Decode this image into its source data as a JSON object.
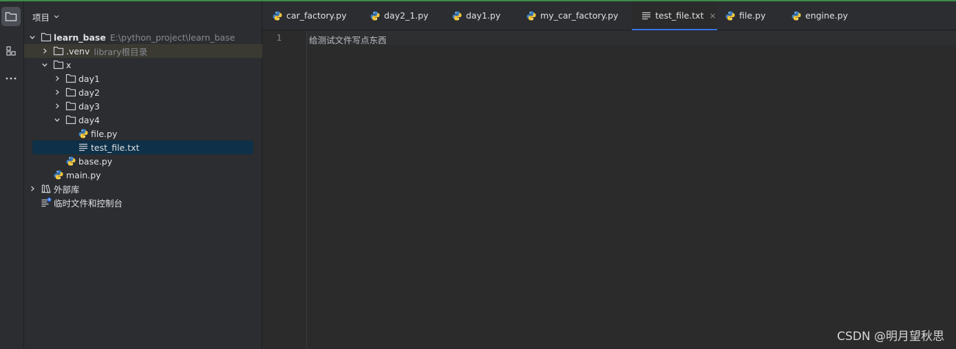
{
  "project_panel": {
    "title": "项目",
    "tree": [
      {
        "name": "learn_base",
        "hint": "E:\\python_project\\learn_base",
        "depth": 0,
        "expanded": true,
        "type": "folder"
      },
      {
        "name": ".venv",
        "hint": "library根目录",
        "depth": 1,
        "expanded": false,
        "type": "folder"
      },
      {
        "name": "x",
        "hint": "",
        "depth": 1,
        "expanded": true,
        "type": "folder"
      },
      {
        "name": "day1",
        "hint": "",
        "depth": 2,
        "expanded": false,
        "type": "folder"
      },
      {
        "name": "day2",
        "hint": "",
        "depth": 2,
        "expanded": false,
        "type": "folder"
      },
      {
        "name": "day3",
        "hint": "",
        "depth": 2,
        "expanded": false,
        "type": "folder"
      },
      {
        "name": "day4",
        "hint": "",
        "depth": 2,
        "expanded": true,
        "type": "folder"
      },
      {
        "name": "file.py",
        "hint": "",
        "depth": 3,
        "type": "python"
      },
      {
        "name": "test_file.txt",
        "hint": "",
        "depth": 3,
        "type": "text",
        "selected": true
      },
      {
        "name": "base.py",
        "hint": "",
        "depth": 2,
        "type": "python"
      },
      {
        "name": "main.py",
        "hint": "",
        "depth": 1,
        "type": "python"
      },
      {
        "name": "外部库",
        "hint": "",
        "depth": 0,
        "expanded": false,
        "type": "library"
      },
      {
        "name": "临时文件和控制台",
        "hint": "",
        "depth": 0,
        "type": "scratch"
      }
    ]
  },
  "tabs": [
    {
      "label": "car_factory.py",
      "type": "python"
    },
    {
      "label": "day2_1.py",
      "type": "python"
    },
    {
      "label": "day1.py",
      "type": "python"
    },
    {
      "label": "my_car_factory.py",
      "type": "python"
    },
    {
      "label": "test_file.txt",
      "type": "text",
      "active": true,
      "close": "×"
    },
    {
      "label": "file.py",
      "type": "python"
    },
    {
      "label": "engine.py",
      "type": "python"
    }
  ],
  "editor": {
    "line_number": "1",
    "content": "给测试文件写点东西"
  },
  "watermark": "CSDN @明月望秋思",
  "colors": {
    "accent": "#3574f0",
    "selection": "#0e3048",
    "venv_highlight": "#3b3a32"
  }
}
